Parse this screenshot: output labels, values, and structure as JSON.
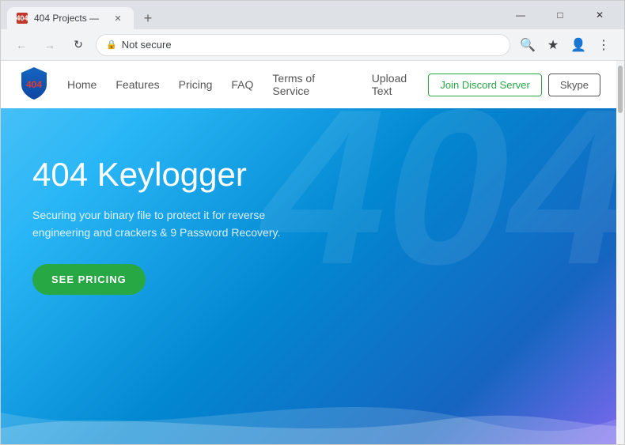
{
  "browser": {
    "tab_title": "404 Projects —",
    "tab_favicon": "404",
    "address": "Not secure",
    "url": ""
  },
  "nav": {
    "logo_text": "404",
    "links": [
      {
        "label": "Home",
        "id": "home"
      },
      {
        "label": "Features",
        "id": "features"
      },
      {
        "label": "Pricing",
        "id": "pricing"
      },
      {
        "label": "FAQ",
        "id": "faq"
      },
      {
        "label": "Terms of Service",
        "id": "tos"
      },
      {
        "label": "Upload Text",
        "id": "upload"
      }
    ],
    "btn_discord": "Join Discord Server",
    "btn_skype": "Skype"
  },
  "hero": {
    "title": "404 Keylogger",
    "subtitle": "Securing your binary file to protect it for reverse engineering and crackers & 9 Password Recovery.",
    "btn_pricing": "SEE PRICING"
  },
  "watermark": "404",
  "window": {
    "minimize": "—",
    "maximize": "□",
    "close": "✕"
  }
}
